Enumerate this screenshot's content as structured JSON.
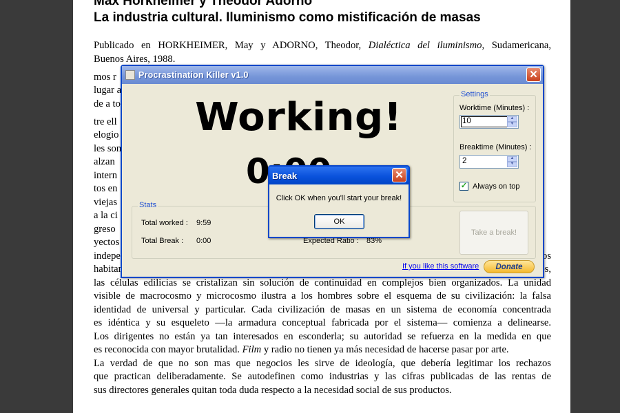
{
  "document": {
    "title_line1": "Max Horkheimer y Theodor Adorno",
    "title_line2": "La industria cultural. Iluminismo como mistificación de masas",
    "pub_prefix": "Publicado en HORKHEIMER, May y ADORNO, Theodor, ",
    "pub_book": "Dialéctica del iluminismo",
    "pub_suffix": ", Sudamericana,",
    "pub_line2": "Buenos Aires, 1988.",
    "lines": [
      "mos r",
      "lugar a",
      "de a to",
      "tre ell",
      "elogio",
      "les son",
      "alzan",
      "intern",
      "tos en",
      "viejas",
      "a la ci",
      "greso",
      "yectos"
    ],
    "body_lines": [
      "independiente, lo someten aún más radicalmente a su antítesis, al poder total del capital. Como los",
      "habitantes afluyen a los centros a fin de trabajar y divertirse, en carácter de productores y consumidores,",
      "las células edilicias se cristalizan sin solución de continuidad en complejos bien organizados. La unidad",
      "visible de macrocosmo y microcosmo ilustra a los hombres sobre el esquema de su civilización: la falsa",
      "identidad de universal y particular. Cada civilización de masas en un sistema de economía concentrada",
      "es idéntica y su esqueleto —la armadura conceptual fabricada por el sistema— comienza a delinearse.",
      "Los dirigentes no están ya tan interesados en esconderla; su autoridad se refuerza en la medida en que",
      "es reconocida con mayor brutalidad. ",
      "La verdad de que no son mas que negocios les sirve de ideología, que debería legitimar los rechazos",
      "que practican deliberadamente. Se autodefinen como industrias y las cifras publicadas de las rentas de",
      "sus directores generales quitan toda duda respecto a la necesidad social de sus productos."
    ],
    "film_word": "Film",
    "film_rest": " y radio no tienen ya más necesidad de hacerse pasar por arte."
  },
  "app": {
    "title": "Procrastination Killer v1.0",
    "close_glyph": "✕",
    "status": "Working!",
    "timer": "0:00",
    "settings": {
      "label": "Settings",
      "worktime_label": "Worktime (Minutes) :",
      "worktime_value": "10",
      "breaktime_label": "Breaktime (Minutes) :",
      "breaktime_value": "2",
      "always_on_top_label": "Always on top",
      "always_on_top_checked": true,
      "check_glyph": "✓",
      "spin_up": "▲",
      "spin_down": "▼"
    },
    "stats": {
      "label": "Stats",
      "total_worked_label": "Total worked :",
      "total_worked_value": "9:59",
      "total_break_label": "Total Break :",
      "total_break_value": "0:00",
      "expected_label": "Expected Ratio :",
      "expected_value": "83%"
    },
    "take_break_label": "Take a break!",
    "link_text": "If you like this software",
    "donate_label": "Donate"
  },
  "dialog": {
    "title": "Break",
    "close_glyph": "✕",
    "message": "Click OK when you'll start your break!",
    "ok_label": "OK"
  },
  "colors": {
    "window_border": "#0a47c9",
    "group_label": "#1f4fd1",
    "link": "#0000ee",
    "donate": "#f5b92e"
  }
}
